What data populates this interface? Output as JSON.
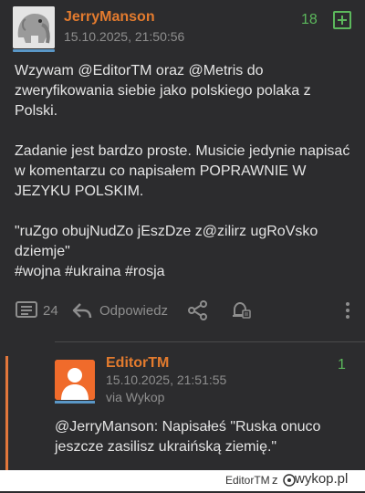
{
  "post": {
    "username": "JerryManson",
    "timestamp": "15.10.2025, 21:50:56",
    "votes": "18",
    "paragraphs": [
      "Wzywam @EditorTM oraz @Metris do zweryfikowania siebie jako polskiego polaka z Polski.",
      "Zadanie jest bardzo proste. Musicie jedynie napisać w komentarzu co napisałem POPRAWNIE W JEZYKU POLSKIM.",
      "\"ruZgo obujNudZo jEszDze z@zilirz ugRoVsko dziemje\"",
      "#wojna #ukraina #rosja"
    ],
    "actions": {
      "comments_count": "24",
      "reply_label": "Odpowiedz"
    }
  },
  "reply": {
    "username": "EditorTM",
    "timestamp": "15.10.2025, 21:51:55",
    "via": "via Wykop",
    "votes": "1",
    "text": "@JerryManson: Napisałeś \"Ruska onuco jeszcze zasilisz ukraińską ziemię.\""
  },
  "footer": {
    "user": "EditorTM",
    "z": "z",
    "brand": "wykop.pl"
  },
  "colors": {
    "background": "#2c2c2e",
    "username": "#e37b2e",
    "vote": "#5cb85c",
    "muted": "#8e8e8e",
    "accent_bar": "#5a97c7",
    "reply_rail": "#e3773b"
  },
  "icons": [
    "elephant-avatar",
    "plus-icon",
    "comments-icon",
    "reply-icon",
    "share-icon",
    "notify-icon",
    "more-icon",
    "default-avatar"
  ]
}
